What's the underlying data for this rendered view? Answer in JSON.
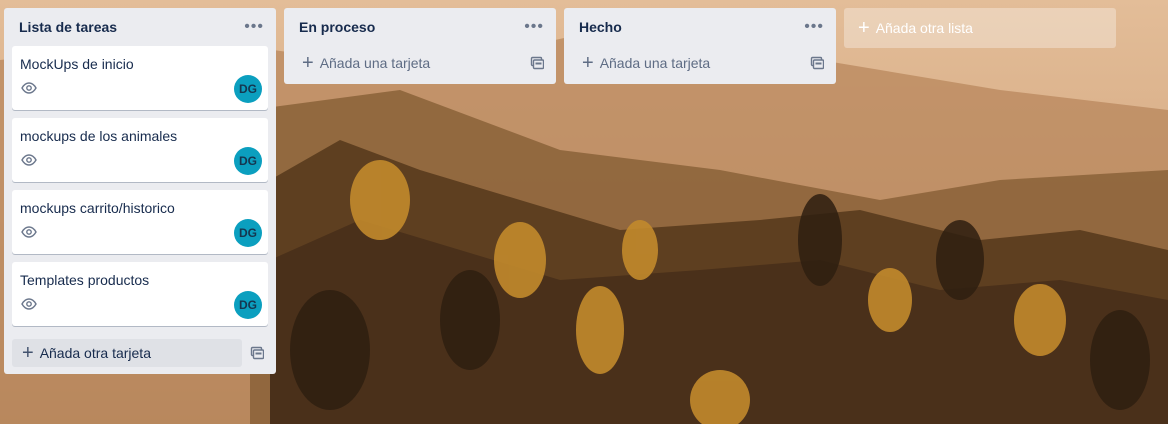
{
  "lists": [
    {
      "title": "Lista de tareas",
      "menu_icon": "more-horizontal-icon",
      "cards": [
        {
          "title": "MockUps de inicio",
          "member": "DG"
        },
        {
          "title": "mockups de los animales",
          "member": "DG"
        },
        {
          "title": "mockups carrito/historico",
          "member": "DG"
        },
        {
          "title": "Templates productos",
          "member": "DG"
        }
      ],
      "add_label": "Añada otra tarjeta"
    },
    {
      "title": "En proceso",
      "menu_icon": "more-horizontal-icon",
      "cards": [],
      "add_label": "Añada una tarjeta"
    },
    {
      "title": "Hecho",
      "menu_icon": "more-horizontal-icon",
      "cards": [],
      "add_label": "Añada una tarjeta"
    }
  ],
  "add_list_label": "Añada otra lista",
  "colors": {
    "list_bg": "#ebecf0",
    "card_bg": "#ffffff",
    "avatar_bg": "#0b9fbf",
    "text": "#172b4d",
    "muted": "#5e6c84"
  }
}
